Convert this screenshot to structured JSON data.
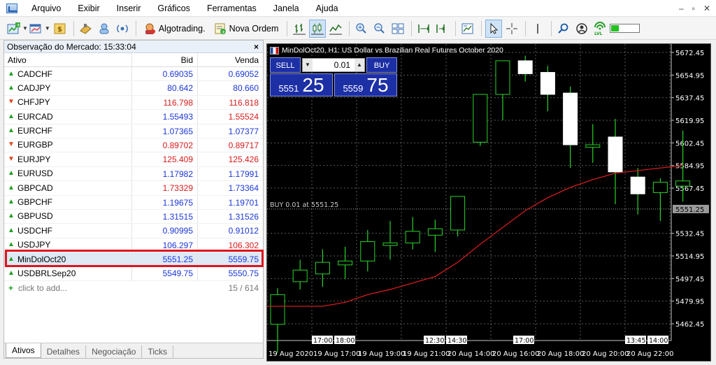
{
  "menu": [
    "Arquivo",
    "Exibir",
    "Inserir",
    "Gráficos",
    "Ferramentas",
    "Janela",
    "Ajuda"
  ],
  "toolbar": {
    "algotrading_label": "Algotrading.",
    "new_order_label": "Nova Ordem"
  },
  "market_watch": {
    "title": "Observação do Mercado: 15:33:04",
    "columns": {
      "symbol": "Ativo",
      "bid": "Bid",
      "ask": "Venda"
    },
    "rows": [
      {
        "symbol": "CADCHF",
        "bid": "0.69035",
        "ask": "0.69052",
        "dir": "up",
        "bid_color": "blue",
        "ask_color": "blue"
      },
      {
        "symbol": "CADJPY",
        "bid": "80.642",
        "ask": "80.660",
        "dir": "up",
        "bid_color": "blue",
        "ask_color": "blue"
      },
      {
        "symbol": "CHFJPY",
        "bid": "116.798",
        "ask": "116.818",
        "dir": "down",
        "bid_color": "red",
        "ask_color": "red"
      },
      {
        "symbol": "EURCAD",
        "bid": "1.55493",
        "ask": "1.55524",
        "dir": "up",
        "bid_color": "blue",
        "ask_color": "red"
      },
      {
        "symbol": "EURCHF",
        "bid": "1.07365",
        "ask": "1.07377",
        "dir": "up",
        "bid_color": "blue",
        "ask_color": "blue"
      },
      {
        "symbol": "EURGBP",
        "bid": "0.89702",
        "ask": "0.89717",
        "dir": "down",
        "bid_color": "red",
        "ask_color": "red"
      },
      {
        "symbol": "EURJPY",
        "bid": "125.409",
        "ask": "125.426",
        "dir": "down",
        "bid_color": "red",
        "ask_color": "red"
      },
      {
        "symbol": "EURUSD",
        "bid": "1.17982",
        "ask": "1.17991",
        "dir": "up",
        "bid_color": "blue",
        "ask_color": "blue"
      },
      {
        "symbol": "GBPCAD",
        "bid": "1.73329",
        "ask": "1.73364",
        "dir": "up",
        "bid_color": "red",
        "ask_color": "blue"
      },
      {
        "symbol": "GBPCHF",
        "bid": "1.19675",
        "ask": "1.19701",
        "dir": "up",
        "bid_color": "blue",
        "ask_color": "blue"
      },
      {
        "symbol": "GBPUSD",
        "bid": "1.31515",
        "ask": "1.31526",
        "dir": "up",
        "bid_color": "blue",
        "ask_color": "blue"
      },
      {
        "symbol": "USDCHF",
        "bid": "0.90995",
        "ask": "0.91012",
        "dir": "up",
        "bid_color": "blue",
        "ask_color": "blue"
      },
      {
        "symbol": "USDJPY",
        "bid": "106.297",
        "ask": "106.302",
        "dir": "up",
        "bid_color": "blue",
        "ask_color": "red"
      },
      {
        "symbol": "MinDolOct20",
        "bid": "5551.25",
        "ask": "5559.75",
        "dir": "up",
        "bid_color": "blue",
        "ask_color": "blue",
        "selected": true
      },
      {
        "symbol": "USDBRLSep20",
        "bid": "5549.75",
        "ask": "5550.75",
        "dir": "up",
        "bid_color": "blue",
        "ask_color": "blue"
      }
    ],
    "add_label": "click to add...",
    "count": "15 / 614",
    "tabs": [
      "Ativos",
      "Detalhes",
      "Negociação",
      "Ticks"
    ]
  },
  "chart": {
    "title": "MinDolOct20, H1:  US Dollar vs Brazilian Real Futures October 2020",
    "trade_panel": {
      "sell_label": "SELL",
      "buy_label": "BUY",
      "lot": "0.01",
      "sell_small": "5551",
      "sell_big": "25",
      "buy_small": "5559",
      "buy_big": "75"
    },
    "position_label": "BUY 0.01 at 5551.25",
    "current_price_label": "5551.25"
  },
  "chart_data": {
    "type": "candlestick",
    "y_ticks": [
      "5672.45",
      "5654.95",
      "5637.45",
      "5619.95",
      "5602.45",
      "5584.95",
      "5567.45",
      "5532.45",
      "5514.95",
      "5497.45",
      "5479.95",
      "5462.45"
    ],
    "ylim": [
      5450,
      5680
    ],
    "x_labels": [
      "19 Aug 2020",
      "19 Aug 17:00",
      "19 Aug 19:00",
      "19 Aug 21:00",
      "20 Aug 14:00",
      "20 Aug 16:00",
      "20 Aug 18:00",
      "20 Aug 20:00",
      "20 Aug 22:00"
    ],
    "x_top_labels": [
      "17:00",
      "18:00",
      "12:30",
      "14:30",
      "17:00",
      "13:45",
      "14:00"
    ],
    "current_price": 5551.25,
    "grid": true,
    "candles": [
      {
        "o": 5462,
        "h": 5490,
        "l": 5440,
        "c": 5485
      },
      {
        "o": 5495,
        "h": 5512,
        "l": 5489,
        "c": 5504
      },
      {
        "o": 5501,
        "h": 5520,
        "l": 5491,
        "c": 5510
      },
      {
        "o": 5508,
        "h": 5522,
        "l": 5497,
        "c": 5511
      },
      {
        "o": 5511,
        "h": 5535,
        "l": 5503,
        "c": 5526
      },
      {
        "o": 5523,
        "h": 5542,
        "l": 5512,
        "c": 5525
      },
      {
        "o": 5525,
        "h": 5545,
        "l": 5520,
        "c": 5534
      },
      {
        "o": 5531,
        "h": 5543,
        "l": 5518,
        "c": 5536
      },
      {
        "o": 5535,
        "h": 5559,
        "l": 5530,
        "c": 5561
      },
      {
        "o": 5603,
        "h": 5640,
        "l": 5600,
        "c": 5640
      },
      {
        "o": 5640,
        "h": 5662,
        "l": 5620,
        "c": 5666
      },
      {
        "o": 5666,
        "h": 5670,
        "l": 5650,
        "c": 5656
      },
      {
        "o": 5657,
        "h": 5662,
        "l": 5627,
        "c": 5640
      },
      {
        "o": 5641,
        "h": 5646,
        "l": 5583,
        "c": 5601
      },
      {
        "o": 5599,
        "h": 5617,
        "l": 5587,
        "c": 5601
      },
      {
        "o": 5607,
        "h": 5621,
        "l": 5555,
        "c": 5580
      },
      {
        "o": 5576,
        "h": 5583,
        "l": 5547,
        "c": 5563
      },
      {
        "o": 5564,
        "h": 5575,
        "l": 5542,
        "c": 5572
      },
      {
        "o": 5569,
        "h": 5612,
        "l": 5557,
        "c": 5573
      }
    ],
    "ma_line": [
      5476,
      5476,
      5476,
      5479,
      5485,
      5489,
      5494,
      5499,
      5510,
      5524,
      5537,
      5550,
      5560,
      5568,
      5574,
      5579,
      5581,
      5583,
      5585
    ]
  }
}
